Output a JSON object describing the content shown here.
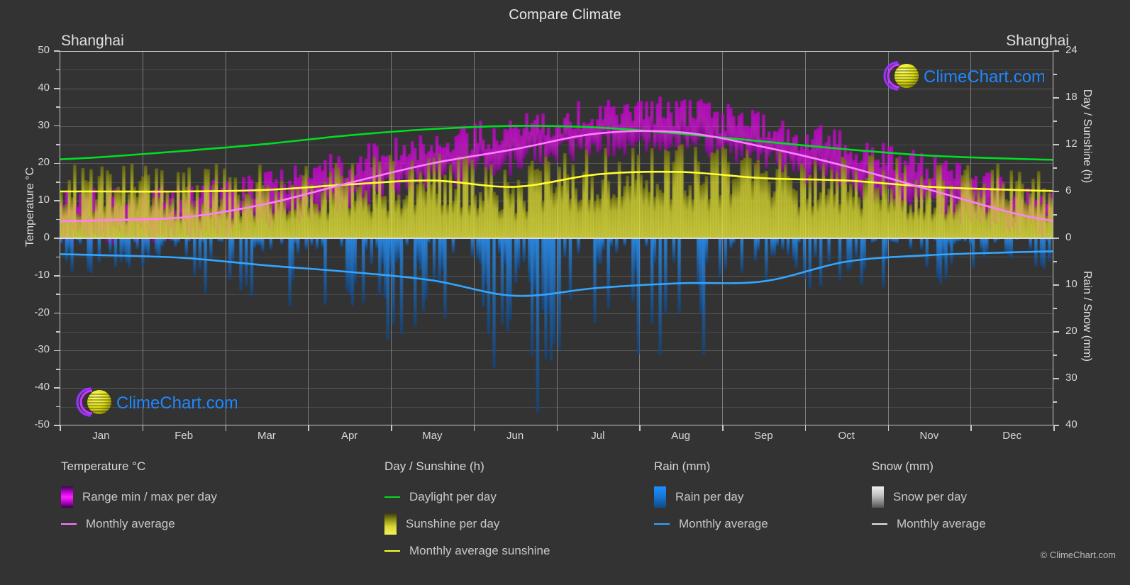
{
  "header": {
    "title": "Compare Climate",
    "city_left": "Shanghai",
    "city_right": "Shanghai"
  },
  "brand": {
    "name": "ClimeChart.com",
    "copyright": "© ClimeChart.com",
    "text_color": "#1e88ff",
    "arc_color": "#cc33ff",
    "sphere_color": "#e0e000"
  },
  "axes": {
    "left_title": "Temperature °C",
    "right_title_top": "Day / Sunshine (h)",
    "right_title_bottom": "Rain / Snow (mm)",
    "left_ticks": [
      "50",
      "40",
      "30",
      "20",
      "10",
      "0",
      "-10",
      "-20",
      "-30",
      "-40",
      "-50"
    ],
    "right_ticks_top": [
      "24",
      "18",
      "12",
      "6",
      "0"
    ],
    "right_ticks_bottom": [
      "10",
      "20",
      "30",
      "40"
    ],
    "x_ticks": [
      "Jan",
      "Feb",
      "Mar",
      "Apr",
      "May",
      "Jun",
      "Jul",
      "Aug",
      "Sep",
      "Oct",
      "Nov",
      "Dec"
    ]
  },
  "legend": {
    "groups": [
      {
        "heading": "Temperature °C",
        "items": [
          {
            "label": "Range min / max per day",
            "marker": "box",
            "color": "#ee00ee"
          },
          {
            "label": "Monthly average",
            "marker": "line",
            "color": "#ff7fff"
          }
        ]
      },
      {
        "heading": "Day / Sunshine (h)",
        "items": [
          {
            "label": "Daylight per day",
            "marker": "line",
            "color": "#00dd22"
          },
          {
            "label": "Sunshine per day",
            "marker": "box",
            "color": "#e8e83c"
          },
          {
            "label": "Monthly average sunshine",
            "marker": "line",
            "color": "#ffff33"
          }
        ]
      },
      {
        "heading": "Rain (mm)",
        "items": [
          {
            "label": "Rain per day",
            "marker": "box",
            "color": "#1f8fff"
          },
          {
            "label": "Monthly average",
            "marker": "line",
            "color": "#33a6ff"
          }
        ]
      },
      {
        "heading": "Snow (mm)",
        "items": [
          {
            "label": "Snow per day",
            "marker": "box",
            "color": "#dddddd"
          },
          {
            "label": "Monthly average",
            "marker": "line",
            "color": "#e6e6e6"
          }
        ]
      }
    ]
  },
  "chart_data": {
    "type": "line",
    "title": "Compare Climate",
    "subtitle": "Shanghai",
    "xlabel": "",
    "ylabel": "Temperature °C",
    "grid": true,
    "legend_position": "bottom",
    "x": [
      "Jan",
      "Feb",
      "Mar",
      "Apr",
      "May",
      "Jun",
      "Jul",
      "Aug",
      "Sep",
      "Oct",
      "Nov",
      "Dec"
    ],
    "axis_left": {
      "label": "Temperature °C",
      "min": -50,
      "max": 50,
      "tick_step": 10,
      "minor_step": 5
    },
    "axis_right_top": {
      "label": "Day / Sunshine (h)",
      "min": 0,
      "max": 24,
      "tick_step": 6,
      "maps_to_temp": [
        0,
        50
      ]
    },
    "axis_right_bottom": {
      "label": "Rain / Snow (mm)",
      "min": 0,
      "max": 40,
      "tick_step": 10,
      "maps_to_temp": [
        0,
        -50
      ]
    },
    "series": [
      {
        "name": "Monthly average",
        "unit": "°C",
        "color": "#ff7fff",
        "axis": "left",
        "values": [
          4.8,
          5.6,
          9.2,
          14.8,
          20.0,
          23.8,
          28.0,
          28.3,
          24.4,
          19.2,
          13.0,
          6.8
        ]
      },
      {
        "name": "Daylight per day",
        "unit": "h",
        "color": "#00dd22",
        "axis": "right_top",
        "values": [
          10.4,
          11.2,
          12.1,
          13.2,
          14.0,
          14.4,
          14.2,
          13.4,
          12.4,
          11.4,
          10.6,
          10.2
        ]
      },
      {
        "name": "Monthly average sunshine",
        "unit": "h",
        "color": "#ffff33",
        "axis": "right_top",
        "values": [
          6.0,
          6.0,
          6.2,
          6.9,
          7.4,
          6.6,
          8.2,
          8.5,
          7.7,
          7.4,
          6.6,
          6.2
        ]
      },
      {
        "name": "Rain monthly average",
        "unit": "mm",
        "color": "#33a6ff",
        "axis": "right_bottom",
        "values": [
          3.6,
          4.2,
          5.8,
          7.2,
          9.0,
          12.3,
          10.6,
          9.6,
          9.2,
          5.0,
          3.6,
          3.0
        ]
      },
      {
        "name": "Range max per day",
        "unit": "°C",
        "color": "#ee00ee",
        "axis": "left",
        "values": [
          8.5,
          9.5,
          13.5,
          19.5,
          24.5,
          28.0,
          33.0,
          33.5,
          29.0,
          23.5,
          17.5,
          11.0
        ]
      },
      {
        "name": "Range min per day",
        "unit": "°C",
        "color": "#ee00ee",
        "axis": "left",
        "values": [
          1.5,
          2.5,
          5.5,
          10.5,
          16.0,
          20.5,
          25.0,
          25.5,
          21.0,
          15.0,
          9.0,
          3.5
        ]
      },
      {
        "name": "Snow monthly average",
        "unit": "mm",
        "color": "#e6e6e6",
        "axis": "right_bottom",
        "values": [
          0,
          0,
          0,
          0,
          0,
          0,
          0,
          0,
          0,
          0,
          0,
          0
        ]
      }
    ]
  }
}
